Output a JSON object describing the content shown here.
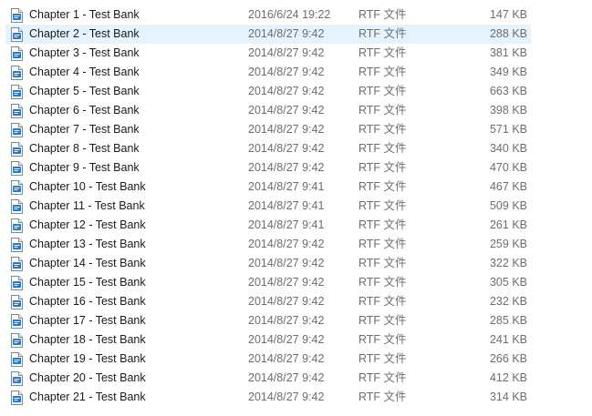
{
  "files": [
    {
      "name": "Chapter 1 - Test Bank",
      "modified": "2016/6/24 19:22",
      "type": "RTF 文件",
      "size": "147 KB"
    },
    {
      "name": "Chapter 2 - Test Bank",
      "modified": "2014/8/27 9:42",
      "type": "RTF 文件",
      "size": "288 KB"
    },
    {
      "name": "Chapter 3 - Test Bank",
      "modified": "2014/8/27 9:42",
      "type": "RTF 文件",
      "size": "381 KB"
    },
    {
      "name": "Chapter 4 - Test Bank",
      "modified": "2014/8/27 9:42",
      "type": "RTF 文件",
      "size": "349 KB"
    },
    {
      "name": "Chapter 5 - Test Bank",
      "modified": "2014/8/27 9:42",
      "type": "RTF 文件",
      "size": "663 KB"
    },
    {
      "name": "Chapter 6 - Test Bank",
      "modified": "2014/8/27 9:42",
      "type": "RTF 文件",
      "size": "398 KB"
    },
    {
      "name": "Chapter 7 - Test Bank",
      "modified": "2014/8/27 9:42",
      "type": "RTF 文件",
      "size": "571 KB"
    },
    {
      "name": "Chapter 8 - Test Bank",
      "modified": "2014/8/27 9:42",
      "type": "RTF 文件",
      "size": "340 KB"
    },
    {
      "name": "Chapter 9 - Test Bank",
      "modified": "2014/8/27 9:42",
      "type": "RTF 文件",
      "size": "470 KB"
    },
    {
      "name": "Chapter 10 - Test Bank",
      "modified": "2014/8/27 9:41",
      "type": "RTF 文件",
      "size": "467 KB"
    },
    {
      "name": "Chapter 11 - Test Bank",
      "modified": "2014/8/27 9:41",
      "type": "RTF 文件",
      "size": "509 KB"
    },
    {
      "name": "Chapter 12 - Test Bank",
      "modified": "2014/8/27 9:41",
      "type": "RTF 文件",
      "size": "261 KB"
    },
    {
      "name": "Chapter 13 - Test Bank",
      "modified": "2014/8/27 9:42",
      "type": "RTF 文件",
      "size": "259 KB"
    },
    {
      "name": "Chapter 14 - Test Bank",
      "modified": "2014/8/27 9:42",
      "type": "RTF 文件",
      "size": "322 KB"
    },
    {
      "name": "Chapter 15 - Test Bank",
      "modified": "2014/8/27 9:42",
      "type": "RTF 文件",
      "size": "305 KB"
    },
    {
      "name": "Chapter 16 - Test Bank",
      "modified": "2014/8/27 9:42",
      "type": "RTF 文件",
      "size": "232 KB"
    },
    {
      "name": "Chapter 17 - Test Bank",
      "modified": "2014/8/27 9:42",
      "type": "RTF 文件",
      "size": "285 KB"
    },
    {
      "name": "Chapter 18 - Test Bank",
      "modified": "2014/8/27 9:42",
      "type": "RTF 文件",
      "size": "241 KB"
    },
    {
      "name": "Chapter 19 - Test Bank",
      "modified": "2014/8/27 9:42",
      "type": "RTF 文件",
      "size": "266 KB"
    },
    {
      "name": "Chapter 20 - Test Bank",
      "modified": "2014/8/27 9:42",
      "type": "RTF 文件",
      "size": "412 KB"
    },
    {
      "name": "Chapter 21 - Test Bank",
      "modified": "2014/8/27 9:42",
      "type": "RTF 文件",
      "size": "314 KB"
    }
  ],
  "hovered_row": 1,
  "icon": "rtf-document-icon",
  "colors": {
    "hover_background": "#e5f3ff",
    "icon_accent": "#2b78c5"
  }
}
